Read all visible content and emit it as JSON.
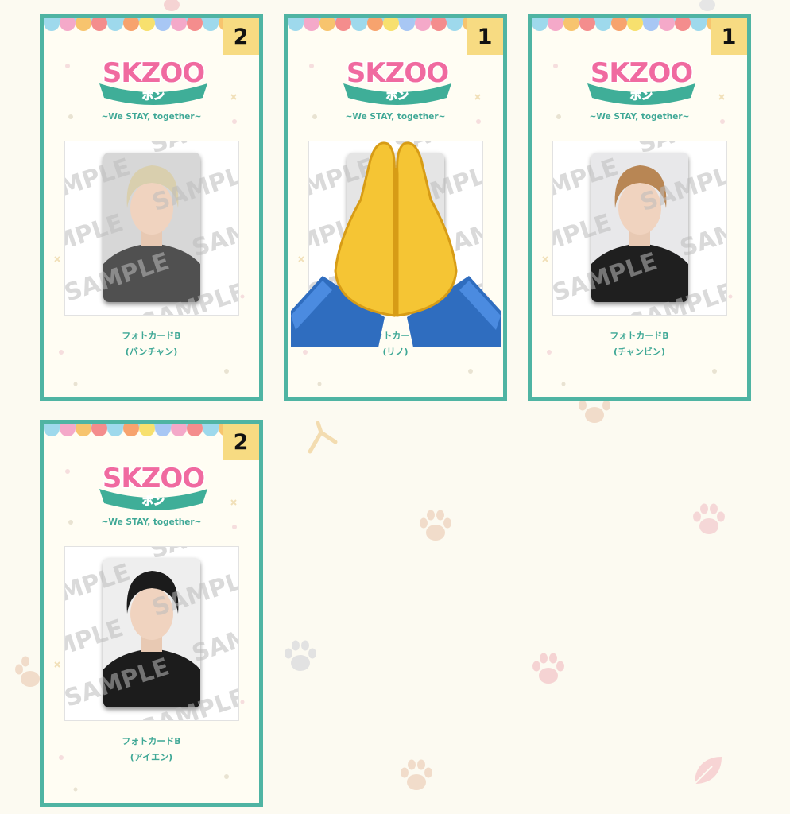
{
  "cards": [
    {
      "count": "2",
      "logo_text": "SKZOO",
      "logo_ribbon": "ポン",
      "tagline": "~We STAY, together~",
      "item_name": "フォトカードB",
      "member": "(バンチャン)",
      "photo_subject": "blond-hair-photocard"
    },
    {
      "count": "1",
      "logo_text": "SKZOO",
      "logo_ribbon": "ポン",
      "tagline": "~We STAY, together~",
      "item_name": "フォトカードB",
      "member": "(リノ)",
      "photo_subject": "photocard-covered-by-folded-hands-emoji"
    },
    {
      "count": "1",
      "logo_text": "SKZOO",
      "logo_ribbon": "ポン",
      "tagline": "~We STAY, together~",
      "item_name": "フォトカードB",
      "member": "(チャンビン)",
      "photo_subject": "light-brown-hair-photocard"
    },
    {
      "count": "2",
      "logo_text": "SKZOO",
      "logo_ribbon": "ポン",
      "tagline": "~We STAY, together~",
      "item_name": "フォトカードB",
      "member": "(アイエン)",
      "photo_subject": "dark-hair-photocard"
    }
  ],
  "watermark": "SAMPLE",
  "colors": {
    "frame": "#4fb4a3",
    "count_badge": "#f7db82",
    "label_text": "#3fa896",
    "page_background": "#fcfaf1"
  },
  "icons": [
    "paw-print-icon",
    "folded-hands-emoji"
  ]
}
